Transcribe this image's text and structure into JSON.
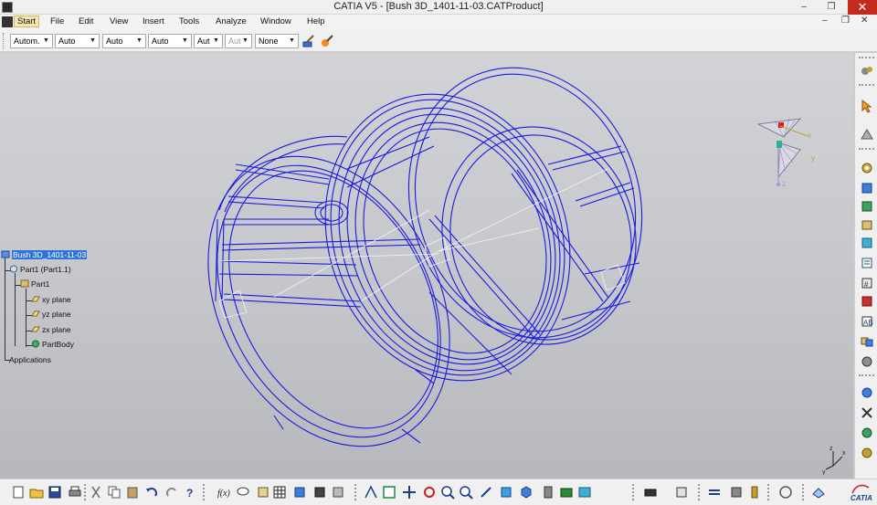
{
  "window": {
    "title": "CATIA V5 - [Bush 3D_1401-11-03.CATProduct]",
    "min_glyph": "–",
    "restore_glyph": "❒",
    "close_glyph": "✕",
    "mdi_min_glyph": "–",
    "mdi_restore_glyph": "❒",
    "mdi_close_glyph": "✕"
  },
  "menu": {
    "items": [
      {
        "label": "Start",
        "active": true
      },
      {
        "label": "File"
      },
      {
        "label": "Edit"
      },
      {
        "label": "View"
      },
      {
        "label": "Insert"
      },
      {
        "label": "Tools"
      },
      {
        "label": "Analyze"
      },
      {
        "label": "Window"
      },
      {
        "label": "Help"
      }
    ]
  },
  "toolbar": {
    "dropdowns": [
      {
        "value": "Autom."
      },
      {
        "value": "Auto"
      },
      {
        "value": "Auto"
      },
      {
        "value": "Auto"
      },
      {
        "value": "Aut"
      },
      {
        "value": "Aut",
        "disabled": true
      },
      {
        "value": "None"
      }
    ],
    "icons": [
      "painter-brush-icon",
      "format-painter-icon"
    ]
  },
  "tree": {
    "root": "Bush 3D_1401-11-03",
    "part_instance": "Part1 (Part1.1)",
    "part": "Part1",
    "planes": [
      "xy plane",
      "yz plane",
      "zx plane"
    ],
    "body": "PartBody",
    "applications": "Applications"
  },
  "compass": {
    "x_label": "x",
    "y_label": "y",
    "z_label": "z"
  },
  "axis_triad": {
    "x_label": "x",
    "y_label": "y",
    "z_label": "z"
  },
  "colors": {
    "wireframe": "#1a1adf",
    "selection": "#2f74d8",
    "viewport_bg": "#c8c9ce"
  },
  "right_toolbar_icons": [
    "part-design-icon",
    "select-arrow-icon",
    "fly-mode-icon",
    "gear-new-component-icon",
    "gear-new-product-icon",
    "gear-new-part-icon",
    "existing-component-icon",
    "replace-component-icon",
    "graph-tree-reorder-icon",
    "generate-numbering-icon",
    "selective-load-icon",
    "manage-representations-icon",
    "multi-instantiation-icon",
    "manipulation-icon",
    "snap-icon",
    "explode-icon",
    "clash-icon",
    "constraint-icon"
  ],
  "bottom_toolbar_icons": [
    "new-icon",
    "open-icon",
    "save-icon",
    "print-icon",
    "cut-icon",
    "copy-icon",
    "paste-icon",
    "undo-icon",
    "redo-icon",
    "whats-this-icon",
    "formula-icon",
    "comment-icon",
    "table-icon",
    "catalog-icon",
    "publication-icon",
    "fly-icon",
    "fit-all-icon",
    "pan-icon",
    "rotate-icon",
    "zoom-in-icon",
    "zoom-out-icon",
    "normal-view-icon",
    "iso-view-icon",
    "cube-view-icon",
    "shading-icon",
    "hide-show-icon",
    "swap-visible-icon",
    "camera-icon",
    "update-icon",
    "measure-icon",
    "move-icon",
    "analysis-icon",
    "sketch-icon",
    "material-icon",
    "catia-logo"
  ]
}
